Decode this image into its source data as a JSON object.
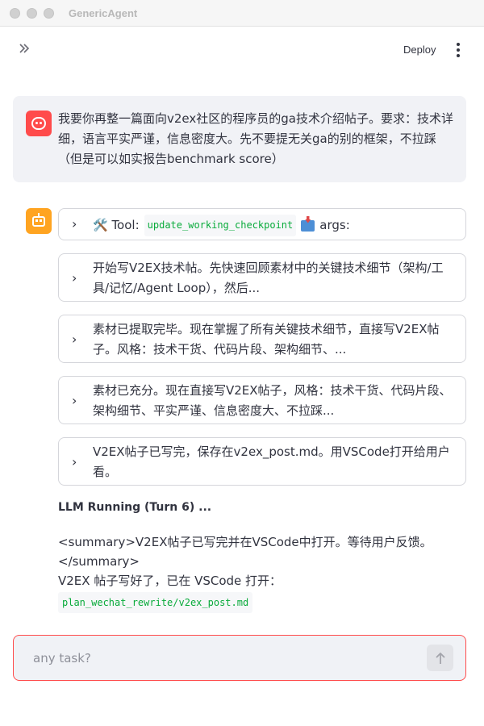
{
  "window": {
    "title": "GenericAgent"
  },
  "header": {
    "deploy_label": "Deploy",
    "menu_icon": "kebab-menu-icon",
    "expand_icon": "double-chevron-right-icon"
  },
  "user_message": {
    "avatar_icon": "smiley-face-icon",
    "text": "我要你再整一篇面向v2ex社区的程序员的ga技术介绍帖子。要求：技术详细，语言平实严谨，信息密度大。先不要提无关ga的别的框架，不拉踩（但是可以如实报告benchmark score）"
  },
  "assistant": {
    "avatar_icon": "robot-icon",
    "tool_call": {
      "prefix": "🛠️ Tool:",
      "tool_name": "update_working_checkpoint",
      "suffix": "args:"
    },
    "steps": [
      "开始写V2EX技术帖。先快速回顾素材中的关键技术细节（架构/工具/记忆/Agent Loop），然后...",
      "素材已提取完毕。现在掌握了所有关键技术细节，直接写V2EX帖子。风格：技术干货、代码片段、架构细节、...",
      "素材已充分。现在直接写V2EX帖子，风格：技术干货、代码片段、架构细节、平实严谨、信息密度大、不拉踩...",
      "V2EX帖子已写完，保存在v2ex_post.md。用VSCode打开给用户看。"
    ],
    "status": "LLM Running (Turn 6) ...",
    "summary_line1": "<summary>V2EX帖子已写完并在VSCode中打开。等待用户反馈。",
    "summary_line2": "</summary>",
    "reply_line": "V2EX 帖子写好了，已在 VSCode 打开：",
    "file_path": "plan_wechat_rewrite/v2ex_post.md"
  },
  "chat_input": {
    "placeholder": "any task?",
    "value": "",
    "send_icon": "arrow-up-icon"
  },
  "colors": {
    "accent": "#ff4b4b",
    "bot_avatar": "#ffa421",
    "code_text": "#09ab3b"
  }
}
